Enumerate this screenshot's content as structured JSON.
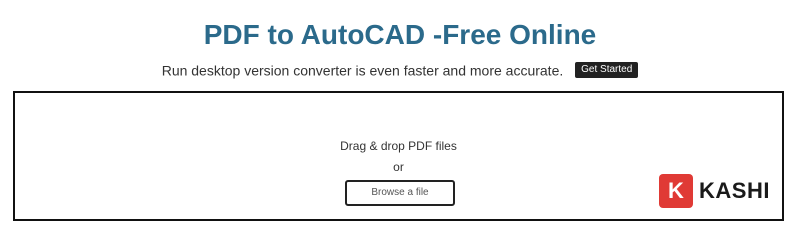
{
  "header": {
    "title": "PDF to AutoCAD -Free Online",
    "subtitle": "Run desktop version converter is even faster and more accurate.",
    "cta_label": "Get Started"
  },
  "dropzone": {
    "drag_text": "Drag & drop PDF files",
    "or_text": "or",
    "browse_label": "Browse a file"
  },
  "watermark": {
    "mark": "K",
    "text": "KASHI"
  },
  "colors": {
    "title": "#2b6a8b",
    "cta_bg": "#222222",
    "logo_red": "#e03a35"
  }
}
